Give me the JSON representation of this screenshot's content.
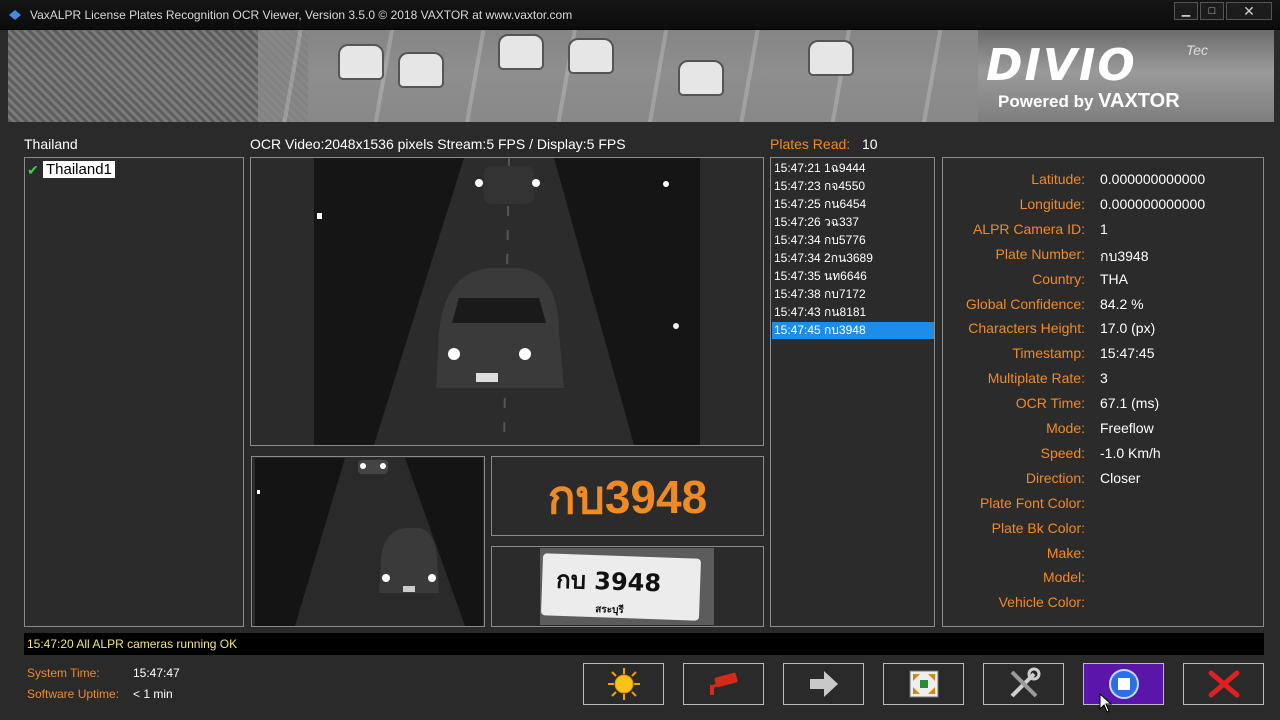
{
  "window": {
    "title": "VaxALPR License Plates Recognition OCR Viewer, Version 3.5.0 © 2018 VAXTOR at www.vaxtor.com",
    "min_label": "▁",
    "max_label": "□",
    "close_label": "✕"
  },
  "banner": {
    "logo": "DIVIO",
    "logo_suffix": "Tec",
    "powered_by": "Powered by",
    "powered_brand": "VAXTOR"
  },
  "cameras": {
    "header": "Thailand",
    "items": [
      {
        "label": "Thailand1",
        "checked": true,
        "icon": "check-icon"
      }
    ]
  },
  "video": {
    "header": "OCR Video:2048x1536 pixels Stream:5 FPS / Display:5 FPS"
  },
  "plate_result": {
    "text": "กบ3948",
    "image_text": "กบ 3948",
    "image_province": "สระบุรี"
  },
  "plates": {
    "header_label": "Plates Read:",
    "count": "10",
    "rows": [
      "15:47:21 1ฉ9444",
      "15:47:23 กจ4550",
      "15:47:25 กน6454",
      "15:47:26 วฉ337",
      "15:47:34 กบ5776",
      "15:47:34 2กน3689",
      "15:47:35 นท6646",
      "15:47:38 กบ7172",
      "15:47:43 กน8181",
      "15:47:45 กบ3948"
    ],
    "selected_index": 9
  },
  "info": [
    {
      "key": "Latitude:",
      "value": "0.000000000000"
    },
    {
      "key": "Longitude:",
      "value": "0.000000000000"
    },
    {
      "key": "ALPR Camera ID:",
      "value": "1"
    },
    {
      "key": "Plate Number:",
      "value": "กบ3948"
    },
    {
      "key": "Country:",
      "value": "THA"
    },
    {
      "key": "Global Confidence:",
      "value": "84.2 %"
    },
    {
      "key": "Characters Height:",
      "value": "17.0 (px)"
    },
    {
      "key": "Timestamp:",
      "value": "15:47:45"
    },
    {
      "key": "Multiplate Rate:",
      "value": "3"
    },
    {
      "key": "OCR Time:",
      "value": "67.1 (ms)"
    },
    {
      "key": "Mode:",
      "value": "Freeflow"
    },
    {
      "key": "Speed:",
      "value": "-1.0 Km/h"
    },
    {
      "key": "Direction:",
      "value": "Closer"
    },
    {
      "key": "Plate Font Color:",
      "value": ""
    },
    {
      "key": "Plate Bk Color:",
      "value": ""
    },
    {
      "key": "Make:",
      "value": ""
    },
    {
      "key": "Model:",
      "value": ""
    },
    {
      "key": "Vehicle Color:",
      "value": ""
    }
  ],
  "status": {
    "message": "15:47:20 All ALPR cameras running OK",
    "system_time_label": "System Time:",
    "system_time": "15:47:47",
    "uptime_label": "Software Uptime:",
    "uptime": "< 1 min"
  },
  "toolbar": [
    {
      "name": "brightness-button",
      "icon": "sun-icon"
    },
    {
      "name": "camera-settings-button",
      "icon": "cctv-camera-icon"
    },
    {
      "name": "next-button",
      "icon": "arrow-right-icon"
    },
    {
      "name": "fullscreen-button",
      "icon": "expand-icon"
    },
    {
      "name": "tools-button",
      "icon": "tools-icon"
    },
    {
      "name": "stop-button",
      "icon": "stop-icon",
      "active": true
    },
    {
      "name": "exit-button",
      "icon": "close-x-icon"
    }
  ],
  "colors": {
    "accent": "#f08a24",
    "selected_row": "#1f8de8",
    "active_button": "#5a16a8",
    "status_text": "#f3e57a"
  }
}
